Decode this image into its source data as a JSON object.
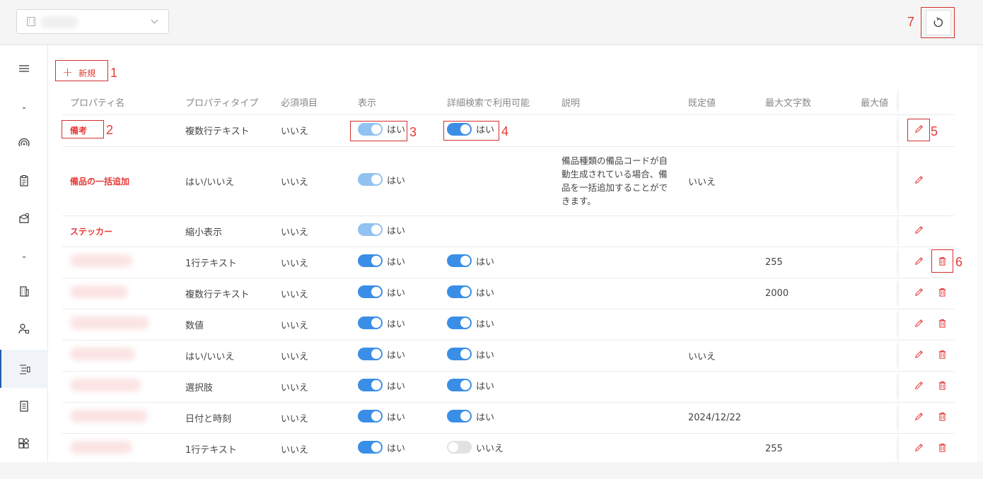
{
  "selector": {
    "value": ""
  },
  "new_button": {
    "label": "新規"
  },
  "annotations": [
    "1",
    "2",
    "3",
    "4",
    "5",
    "6",
    "7"
  ],
  "sidebar": {
    "items": [
      {
        "icon": "menu-icon"
      },
      {
        "label": "-"
      },
      {
        "icon": "signal-icon"
      },
      {
        "icon": "clipboard-icon"
      },
      {
        "icon": "box-settings-icon"
      },
      {
        "label": "-"
      },
      {
        "icon": "building-icon"
      },
      {
        "icon": "user-icon"
      },
      {
        "icon": "property-list-icon",
        "active": true
      },
      {
        "icon": "document-icon"
      },
      {
        "icon": "shapes-icon"
      }
    ]
  },
  "table": {
    "headers": [
      "プロパティ名",
      "プロパティタイプ",
      "必須項目",
      "表示",
      "詳細検索で利用可能",
      "説明",
      "既定値",
      "最大文字数",
      "最大値"
    ],
    "rows": [
      {
        "name": "備考",
        "type": "複数行テキスト",
        "required": "いいえ",
        "display": "はい",
        "display_style": "light",
        "search": "はい",
        "search_state": "on",
        "desc": "",
        "default": "",
        "maxlen": "",
        "maxval": "",
        "deletable": false
      },
      {
        "name": "備品の一括追加",
        "type": "はい/いいえ",
        "required": "いいえ",
        "display": "はい",
        "display_style": "light",
        "search": "",
        "search_state": "none",
        "desc": "備品種類の備品コードが自動生成されている場合、備品を一括追加することができます。",
        "default": "いいえ",
        "maxlen": "",
        "maxval": "",
        "deletable": false
      },
      {
        "name": "ステッカー",
        "type": "縮小表示",
        "required": "いいえ",
        "display": "はい",
        "display_style": "light",
        "search": "",
        "search_state": "none",
        "desc": "",
        "default": "",
        "maxlen": "",
        "maxval": "",
        "deletable": false
      },
      {
        "name": "",
        "type": "1行テキスト",
        "required": "いいえ",
        "display": "はい",
        "display_style": "on",
        "search": "はい",
        "search_state": "on",
        "desc": "",
        "default": "",
        "maxlen": "255",
        "maxval": "",
        "deletable": true
      },
      {
        "name": "",
        "type": "複数行テキスト",
        "required": "いいえ",
        "display": "はい",
        "display_style": "on",
        "search": "はい",
        "search_state": "on",
        "desc": "",
        "default": "",
        "maxlen": "2000",
        "maxval": "",
        "deletable": true
      },
      {
        "name": "",
        "type": "数値",
        "required": "いいえ",
        "display": "はい",
        "display_style": "on",
        "search": "はい",
        "search_state": "on",
        "desc": "",
        "default": "",
        "maxlen": "",
        "maxval": "",
        "deletable": true
      },
      {
        "name": "",
        "type": "はい/いいえ",
        "required": "いいえ",
        "display": "はい",
        "display_style": "on",
        "search": "はい",
        "search_state": "on",
        "desc": "",
        "default": "いいえ",
        "maxlen": "",
        "maxval": "",
        "deletable": true
      },
      {
        "name": "",
        "type": "選択肢",
        "required": "いいえ",
        "display": "はい",
        "display_style": "on",
        "search": "はい",
        "search_state": "on",
        "desc": "",
        "default": "",
        "maxlen": "",
        "maxval": "",
        "deletable": true
      },
      {
        "name": "",
        "type": "日付と時刻",
        "required": "いいえ",
        "display": "はい",
        "display_style": "on",
        "search": "はい",
        "search_state": "on",
        "desc": "",
        "default": "2024/12/22",
        "maxlen": "",
        "maxval": "",
        "deletable": true
      },
      {
        "name": "",
        "type": "1行テキスト",
        "required": "いいえ",
        "display": "はい",
        "display_style": "on",
        "search": "いいえ",
        "search_state": "off",
        "desc": "",
        "default": "",
        "maxlen": "255",
        "maxval": "",
        "deletable": true
      }
    ]
  },
  "colors": {
    "accent_red": "#e53935",
    "toggle_on": "#3a8ee6",
    "toggle_light": "#91c2f2",
    "toggle_off": "#e1e1e1",
    "active_nav": "#1e5fa8"
  }
}
